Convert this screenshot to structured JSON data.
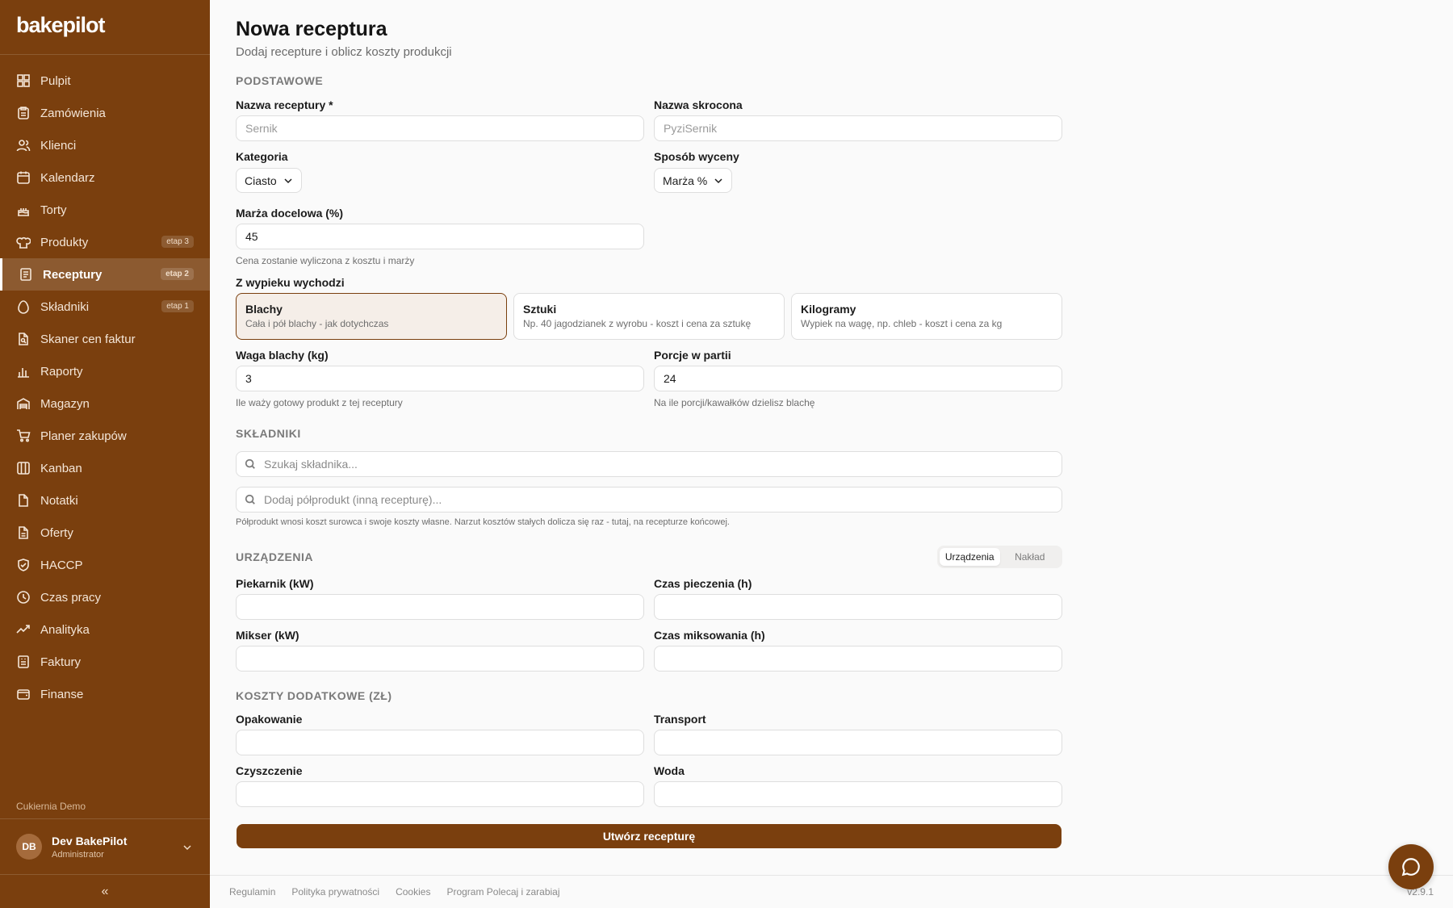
{
  "app": {
    "logo": "bakepilot"
  },
  "sidebar": {
    "items": [
      {
        "label": "Pulpit",
        "icon": "grid-icon"
      },
      {
        "label": "Zamówienia",
        "icon": "clipboard-icon"
      },
      {
        "label": "Klienci",
        "icon": "users-icon"
      },
      {
        "label": "Kalendarz",
        "icon": "calendar-icon"
      },
      {
        "label": "Torty",
        "icon": "cake-icon"
      },
      {
        "label": "Produkty",
        "icon": "chef-hat-icon",
        "badge": "etap 3"
      },
      {
        "label": "Receptury",
        "icon": "receipt-icon",
        "badge": "etap 2",
        "active": true
      },
      {
        "label": "Składniki",
        "icon": "egg-icon",
        "badge": "etap 1"
      },
      {
        "label": "Skaner cen faktur",
        "icon": "file-search-icon"
      },
      {
        "label": "Raporty",
        "icon": "bar-chart-icon"
      },
      {
        "label": "Magazyn",
        "icon": "warehouse-icon"
      },
      {
        "label": "Planer zakupów",
        "icon": "cart-icon"
      },
      {
        "label": "Kanban",
        "icon": "kanban-icon"
      },
      {
        "label": "Notatki",
        "icon": "file-icon"
      },
      {
        "label": "Oferty",
        "icon": "file-text-icon"
      },
      {
        "label": "HACCP",
        "icon": "shield-check-icon"
      },
      {
        "label": "Czas pracy",
        "icon": "clock-icon"
      },
      {
        "label": "Analityka",
        "icon": "trending-up-icon"
      },
      {
        "label": "Faktury",
        "icon": "invoice-icon"
      },
      {
        "label": "Finanse",
        "icon": "wallet-icon"
      }
    ],
    "org": "Cukiernia Demo",
    "user": {
      "initials": "DB",
      "name": "Dev BakePilot",
      "role": "Administrator"
    },
    "collapse": "«"
  },
  "page": {
    "title": "Nowa receptura",
    "subtitle": "Dodaj recepture i oblicz koszty produkcji"
  },
  "basic": {
    "section": "PODSTAWOWE",
    "name_label": "Nazwa receptury *",
    "name_placeholder": "Sernik",
    "short_label": "Nazwa skrocona",
    "short_placeholder": "PyziSernik",
    "category_label": "Kategoria",
    "category_value": "Ciasto",
    "pricing_label": "Sposób wyceny",
    "pricing_value": "Marża %",
    "margin_label": "Marża docelowa (%)",
    "margin_value": "45",
    "margin_hint": "Cena zostanie wyliczona z kosztu i marży",
    "yield_label": "Z wypieku wychodzi",
    "yield_options": [
      {
        "title": "Blachy",
        "desc": "Cała i pół blachy - jak dotychczas",
        "selected": true
      },
      {
        "title": "Sztuki",
        "desc": "Np. 40 jagodzianek z wyrobu - koszt i cena za sztukę",
        "selected": false
      },
      {
        "title": "Kilogramy",
        "desc": "Wypiek na wagę, np. chleb - koszt i cena za kg",
        "selected": false
      }
    ],
    "weight_label": "Waga blachy (kg)",
    "weight_value": "3",
    "weight_hint": "Ile waży gotowy produkt z tej receptury",
    "portions_label": "Porcje w partii",
    "portions_value": "24",
    "portions_hint": "Na ile porcji/kawałków dzielisz blachę"
  },
  "ingredients": {
    "section": "SKŁADNIKI",
    "search_placeholder": "Szukaj składnika...",
    "semi_placeholder": "Dodaj półprodukt (inną recepturę)...",
    "hint": "Półprodukt wnosi koszt surowca i swoje koszty własne. Narzut kosztów stałych dolicza się raz - tutaj, na recepturze końcowej."
  },
  "devices": {
    "section": "URZĄDZENIA",
    "toggle": [
      "Urządzenia",
      "Nakład"
    ],
    "oven_label": "Piekarnik (kW)",
    "bake_time_label": "Czas pieczenia (h)",
    "mixer_label": "Mikser (kW)",
    "mix_time_label": "Czas miksowania (h)"
  },
  "extra": {
    "section": "KOSZTY DODATKOWE (ZŁ)",
    "packaging_label": "Opakowanie",
    "transport_label": "Transport",
    "cleaning_label": "Czyszczenie",
    "water_label": "Woda"
  },
  "submit_label": "Utwórz recepturę",
  "footer": {
    "links": [
      "Regulamin",
      "Polityka prywatności",
      "Cookies",
      "Program Polecaj i zarabiaj"
    ],
    "version": "v2.9.1"
  },
  "colors": {
    "brand": "#7a3f0e"
  }
}
